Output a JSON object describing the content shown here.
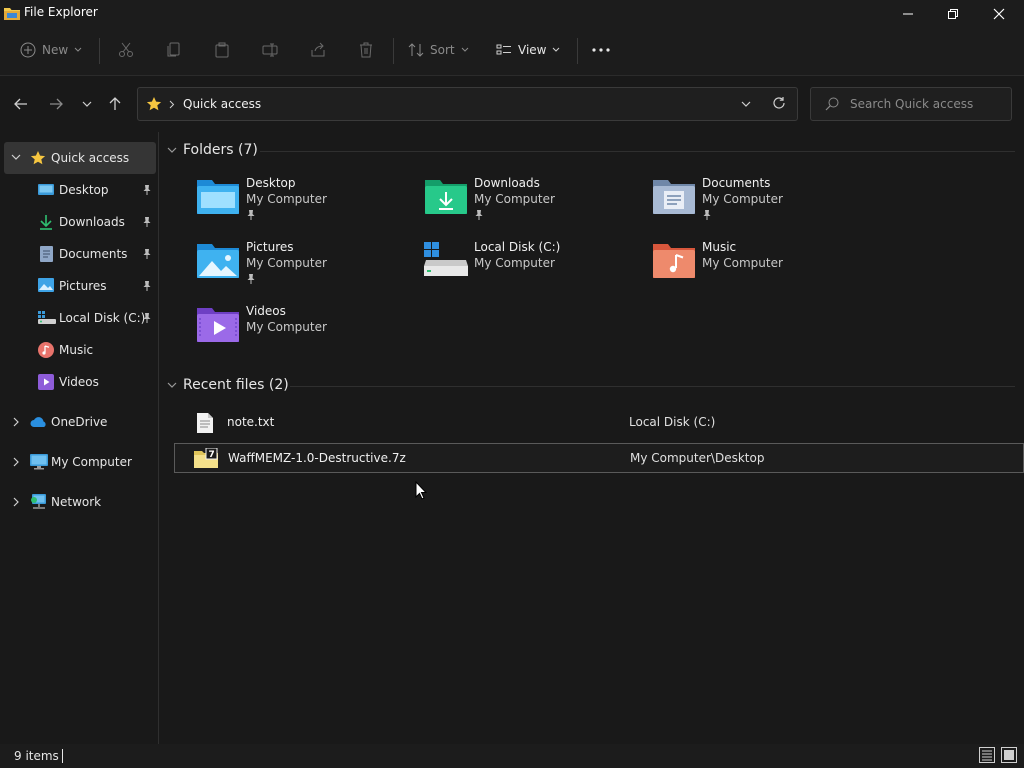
{
  "window": {
    "title": "File Explorer"
  },
  "toolbar": {
    "new_label": "New",
    "sort_label": "Sort",
    "view_label": "View"
  },
  "address": {
    "location": "Quick access"
  },
  "search": {
    "placeholder": "Search Quick access"
  },
  "nav": {
    "items": [
      {
        "label": "Quick access"
      },
      {
        "label": "Desktop"
      },
      {
        "label": "Downloads"
      },
      {
        "label": "Documents"
      },
      {
        "label": "Pictures"
      },
      {
        "label": "Local Disk (C:)"
      },
      {
        "label": "Music"
      },
      {
        "label": "Videos"
      },
      {
        "label": "OneDrive"
      },
      {
        "label": "My Computer"
      },
      {
        "label": "Network"
      }
    ]
  },
  "folders": {
    "header": "Folders (7)",
    "items": [
      {
        "name": "Desktop",
        "location": "My Computer",
        "icon": "desktop-folder-icon"
      },
      {
        "name": "Downloads",
        "location": "My Computer",
        "icon": "downloads-folder-icon"
      },
      {
        "name": "Documents",
        "location": "My Computer",
        "icon": "documents-folder-icon"
      },
      {
        "name": "Pictures",
        "location": "My Computer",
        "icon": "pictures-folder-icon"
      },
      {
        "name": "Local Disk (C:)",
        "location": "My Computer",
        "icon": "drive-icon"
      },
      {
        "name": "Music",
        "location": "My Computer",
        "icon": "music-folder-icon"
      },
      {
        "name": "Videos",
        "location": "My Computer",
        "icon": "videos-folder-icon"
      }
    ]
  },
  "recent": {
    "header": "Recent files (2)",
    "items": [
      {
        "name": "note.txt",
        "location": "Local Disk (C:)",
        "icon": "text-file-icon"
      },
      {
        "name": "WaffMEMZ-1.0-Destructive.7z",
        "location": "My Computer\\Desktop",
        "icon": "archive-file-icon"
      }
    ]
  },
  "status": {
    "items_count": "9 items"
  },
  "colors": {
    "background": "#191919",
    "accent_folder": "#4cc2ff",
    "star": "#f6c640"
  }
}
